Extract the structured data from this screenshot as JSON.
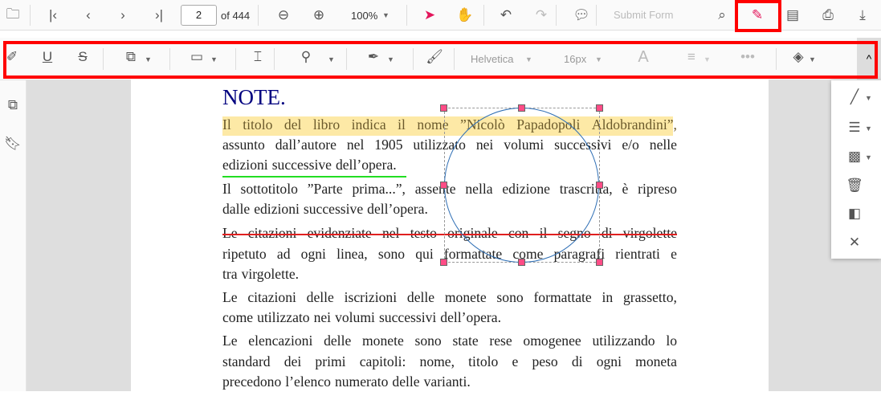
{
  "toolbar": {
    "page_number": "2",
    "page_count": "of 444",
    "zoom": "100%",
    "submit_form": "Submit Form"
  },
  "annotation_toolbar": {
    "font_family": "Helvetica",
    "font_size": "16px"
  },
  "document": {
    "heading": "NOTE.",
    "lines": [
      "Il titolo del libro indica il nome ”Nicolò Papadopoli Aldobrandini”,",
      "assunto dall’autore nel 1905 utilizzato nei volumi successivi e/o nelle",
      "edizioni successive dell’opera.",
      "Il sottotitolo ”Parte prima...”, assente nella edizione trascritta, è ripreso",
      "dalle edizioni successive dell’opera.",
      "Le citazioni evidenziate nel testo originale con il segno di virgolette",
      "ripetuto ad ogni linea, sono qui formattate come paragrafi rientrati e",
      "tra virgolette.",
      "Le citazioni delle iscrizioni delle monete sono formattate in grassetto,",
      "come utilizzato nei volumi successivi dell’opera.",
      "Le elencazioni delle monete sono state rese omogenee utilizzando lo",
      "standard dei primi capitoli: nome, titolo e peso di ogni moneta",
      "precedono l’elenco numerato delle varianti."
    ]
  },
  "colors": {
    "accent": "#e3165b",
    "highlight": "#fde9a6",
    "underline": "#22dd22",
    "strike": "#e02020",
    "circle": "#2f6fb5",
    "heading": "#00007f"
  }
}
